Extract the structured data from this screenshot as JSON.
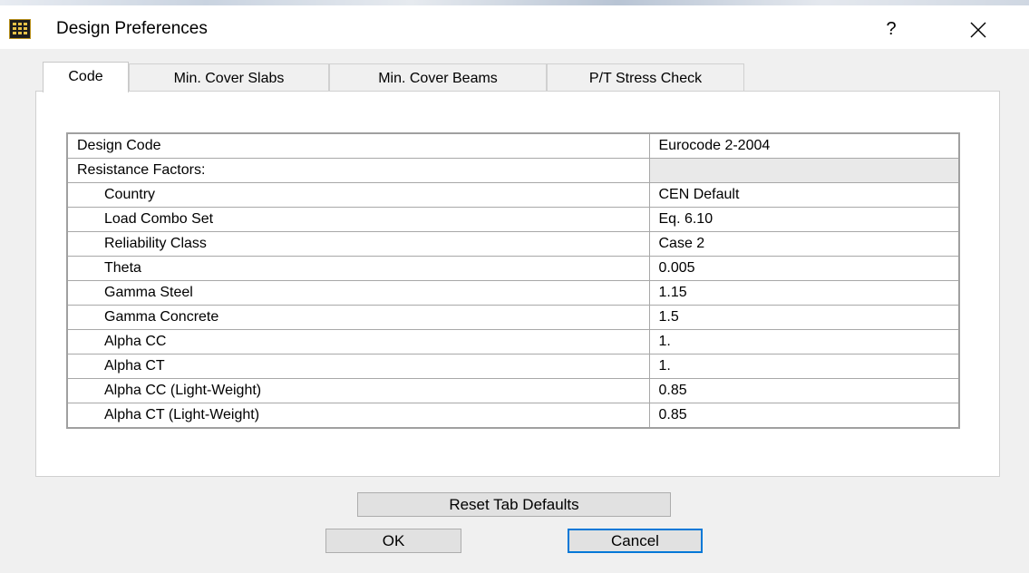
{
  "window": {
    "title": "Design Preferences",
    "help_label": "?"
  },
  "tabs": [
    {
      "label": "Code",
      "active": true
    },
    {
      "label": "Min. Cover Slabs",
      "active": false
    },
    {
      "label": "Min. Cover Beams",
      "active": false
    },
    {
      "label": "P/T Stress Check",
      "active": false
    }
  ],
  "grid": {
    "rows": [
      {
        "name": "Design Code",
        "value": "Eurocode 2-2004"
      },
      {
        "name": "Resistance Factors:",
        "value": ""
      },
      {
        "name": "Country",
        "value": "CEN Default"
      },
      {
        "name": "Load Combo Set",
        "value": "Eq. 6.10"
      },
      {
        "name": "Reliability Class",
        "value": "Case 2"
      },
      {
        "name": "Theta",
        "value": "0.005"
      },
      {
        "name": "Gamma Steel",
        "value": "1.15"
      },
      {
        "name": "Gamma Concrete",
        "value": "1.5"
      },
      {
        "name": "Alpha CC",
        "value": "1."
      },
      {
        "name": "Alpha CT",
        "value": "1."
      },
      {
        "name": "Alpha CC (Light-Weight)",
        "value": "0.85"
      },
      {
        "name": "Alpha CT (Light-Weight)",
        "value": "0.85"
      }
    ]
  },
  "buttons": {
    "reset_label": "Reset Tab Defaults",
    "ok_label": "OK",
    "cancel_label": "Cancel"
  },
  "icons": {
    "app": "app-icon",
    "close": "close-icon"
  },
  "colors": {
    "focus_border": "#0078d7",
    "button_face": "#e1e1e1",
    "dialog_bg": "#f0f0f0"
  }
}
